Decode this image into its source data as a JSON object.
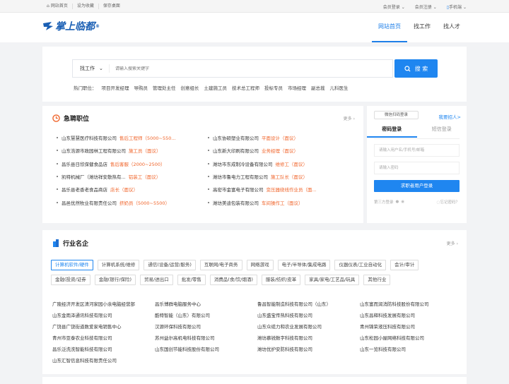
{
  "topbar": {
    "links": [
      "网站首页",
      "设为收藏",
      "保存桌面"
    ],
    "member_login": "会员登录",
    "member_register": "会员注册",
    "mobile": "手机端"
  },
  "header": {
    "logo_text": "掌上临都",
    "logo_mark": "®",
    "nav": [
      "网站首页",
      "找工作",
      "找人才"
    ]
  },
  "search": {
    "select_value": "找工作",
    "placeholder": "请输入搜索关键字",
    "button": "搜 索",
    "hot_label": "热门职位：",
    "hot": [
      "项目开发经理",
      "导购员",
      "管理处主任",
      "创意组长",
      "土建施工员",
      "技术总工程师",
      "投标专员",
      "市场经理",
      "副总裁",
      "儿科医生"
    ]
  },
  "jobs": {
    "title": "急聘职位",
    "more": "更多",
    "rows": [
      [
        {
          "company": "山东慧慧医疗科技有限公司",
          "title": "售后工程师（5000~550..."
        },
        {
          "company": "山东协硕塑业有限公司",
          "title": "平面设计（面议）"
        }
      ],
      [
        {
          "company": "山东浩源市政园林工程有限公司",
          "title": "施工员（面议）"
        },
        {
          "company": "山东新大印刷有限公司",
          "title": "业务经理（面议）"
        }
      ],
      [
        {
          "company": "昌乐县日欣保健食品店",
          "title": "售后客服（2000~2500）"
        },
        {
          "company": "潍坊市东成制冷设备有限公司",
          "title": "维修工（面议）"
        }
      ],
      [
        {
          "company": "凯特机械厂（潍坊祥安散热有...",
          "title": "铝装工（面议）"
        },
        {
          "company": "潍坊市鲁电力工程有限公司",
          "title": "施工队长（面议）"
        }
      ],
      [
        {
          "company": "昌乐县老香老食品商店",
          "title": "店长（面议）"
        },
        {
          "company": "高密市金富电子有限公司",
          "title": "变压器绕线作业员（面..."
        }
      ],
      [
        {
          "company": "昌邑优然牧业有限责任公司",
          "title": "挤奶员（5000~5500）"
        },
        {
          "company": "潍坊美迪包装有限公司",
          "title": "车间操作工（面议）"
        }
      ]
    ]
  },
  "login": {
    "qr": "微信扫码登录",
    "hire": "我要招人>",
    "tabs": [
      "密码登录",
      "短信登录"
    ],
    "user_placeholder": "请输入用户名/手机号/邮箱",
    "pass_placeholder": "请输入密码",
    "button": "求职者用户登录",
    "third": "第三方登录",
    "forgot": "忘记密码？"
  },
  "industry": {
    "title": "行业名企",
    "more": "更多",
    "categories": [
      "计算机软件/硬件",
      "计算机系统/维修",
      "通信(设备/运营/服务)",
      "互联网/电子商务",
      "网络游戏",
      "电子/半导体/集成电路",
      "仪器仪表/工业自动化",
      "会计/审计",
      "金融(投资/证券",
      "金融(银行/保险)",
      "贸易/进出口",
      "批发/零售",
      "消费品(食/饮/烟酒)",
      "服装/纺织/皮革",
      "家具/家电/工艺品/玩具",
      "其他行业"
    ],
    "companies": [
      "广陵经济开发区清河家园小余电脑经营部",
      "昌乐博群电脑服务中心",
      "鲁昌智能制造科技有限公司（山东）",
      "山东富而润消防科技股份有限公司",
      "山东金雨泽通讯科技有限公司",
      "酷特智能（山东）有限公司",
      "山东盛宝传热科技有限公司",
      "山东昌释科技发展有限公司",
      "广饶县广饶街道数爱家电销售中心",
      "汉源环保科技有限公司",
      "山东众缆力和农业发展有限公司",
      "青州锦荣液压科技有限公司",
      "青州市亚泰农业科技有限公司",
      "苏州益尔高机电科技有限公司",
      "潍坊慕锐数字科技有限公司",
      "山东松园小屋网络科技有限公司",
      "昌乐泛洗洗智能科技有限公司",
      "山东国创节能科技股份有限公司",
      "潍坊优护安防科技有限公司",
      "山东一览科技有限公司",
      "山东汇智信息科技有限责任公司"
    ]
  }
}
